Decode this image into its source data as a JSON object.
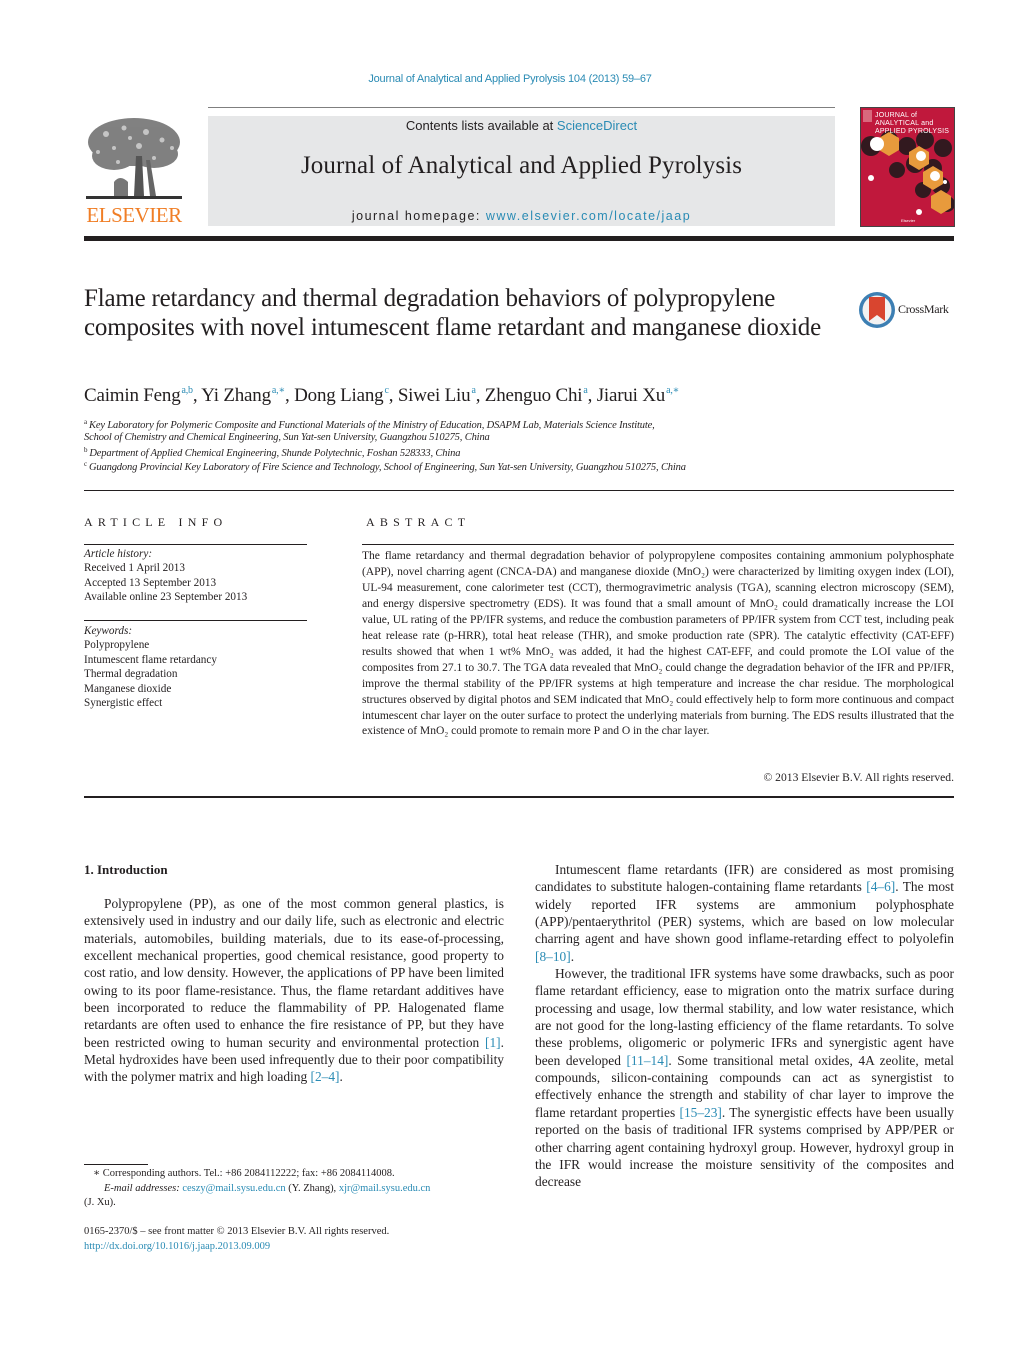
{
  "header": {
    "citation": "Journal of Analytical and Applied Pyrolysis 104 (2013) 59–67",
    "contents_prefix": "Contents lists available at ",
    "contents_link": "ScienceDirect",
    "journal_title": "Journal of Analytical and Applied Pyrolysis",
    "homepage_prefix": "journal homepage: ",
    "homepage_link": "www.elsevier.com/locate/jaap",
    "publisher_logo_text": "ELSEVIER",
    "cover_title_lines": [
      "JOURNAL of",
      "ANALYTICAL and",
      "APPLIED PYROLYSIS"
    ],
    "colors": {
      "link": "#2a8bb4",
      "elsevier_orange": "#f07e26",
      "cover_red": "#c0183c",
      "header_box": "#e6e7e8"
    }
  },
  "article": {
    "title": "Flame retardancy and thermal degradation behaviors of polypropylene composites with novel intumescent flame retardant and manganese dioxide",
    "crossmark_label": "CrossMark",
    "authors": [
      {
        "name": "Caimin Feng",
        "sup": "a,b",
        "sep": ", "
      },
      {
        "name": "Yi Zhang",
        "sup": "a,∗",
        "sep": ", "
      },
      {
        "name": "Dong Liang",
        "sup": "c",
        "sep": ", "
      },
      {
        "name": "Siwei Liu",
        "sup": "a",
        "sep": ", "
      },
      {
        "name": "Zhenguo Chi",
        "sup": "a",
        "sep": ", "
      },
      {
        "name": "Jiarui Xu",
        "sup": "a,∗",
        "sep": ""
      }
    ],
    "affiliations": [
      {
        "sup": "a",
        "text": "Key Laboratory for Polymeric Composite and Functional Materials of the Ministry of Education, DSAPM Lab, Materials Science Institute,"
      },
      {
        "sup": "",
        "text": "School of Chemistry and Chemical Engineering, Sun Yat-sen University, Guangzhou 510275, China"
      },
      {
        "sup": "b",
        "text": "Department of Applied Chemical Engineering, Shunde Polytechnic, Foshan 528333, China"
      },
      {
        "sup": "c",
        "text": "Guangdong Provincial Key Laboratory of Fire Science and Technology, School of Engineering, Sun Yat-sen University, Guangzhou 510275, China"
      }
    ]
  },
  "article_info": {
    "heading": "ARTICLE INFO",
    "history_label": "Article history:",
    "history": [
      "Received 1 April 2013",
      "Accepted 13 September 2013",
      "Available online 23 September 2013"
    ],
    "keywords_label": "Keywords:",
    "keywords": [
      "Polypropylene",
      "Intumescent flame retardancy",
      "Thermal degradation",
      "Manganese dioxide",
      "Synergistic effect"
    ]
  },
  "abstract": {
    "heading": "ABSTRACT",
    "text": "The flame retardancy and thermal degradation behavior of polypropylene composites containing ammo­nium polyphosphate (APP), novel charring agent (CNCA-DA) and manganese dioxide (MnO₂) were characterized by limiting oxygen index (LOI), UL-94 measurement, cone calorimeter test (CCT), ther­mogravimetric analysis (TGA), scanning electron microscopy (SEM), and energy dispersive spectrometry (EDS). It was found that a small amount of MnO₂ could dramatically increase the LOI value, UL rating of the PP/IFR systems, and reduce the combustion parameters of PP/IFR system from CCT test, including peak heat release rate (p-HRR), total heat release (THR), and smoke production rate (SPR). The catalytic effectivity (CAT-EFF) results showed that when 1 wt% MnO₂ was added, it had the highest CAT-EFF, and could promote the LOI value of the composites from 27.1 to 30.7. The TGA data revealed that MnO₂ could change the degradation behavior of the IFR and PP/IFR, improve the thermal stability of the PP/IFR systems at high temperature and increase the char residue. The morphological structures observed by digital photos and SEM indicated that MnO₂ could effectively help to form more continuous and compact intumescent char layer on the outer surface to protect the underlying materials from burning. The EDS results illustrated that the existence of MnO₂ could promote to remain more P and O in the char layer.",
    "copyright": "© 2013 Elsevier B.V. All rights reserved."
  },
  "body": {
    "section_heading": "1.  Introduction",
    "left_paragraphs": [
      [
        {
          "t": "Polypropylene (PP), as one of the most common general plastics, is extensively used in industry and our daily life, such as elec­tronic and electric materials, automobiles, building materials, due to its ease-of-processing, excellent mechanical properties, good chemical resistance, good property to cost ratio, and low density. However, the applications of PP have been limited owing to its poor flame-resistance. Thus, the flame retardant additives have been incorporated to reduce the flammability of PP. Halogenated flame retardants are often used to enhance the fire resistance of PP, but they have been restricted owing to human security and environmental protection "
        },
        {
          "ref": "[1]"
        },
        {
          "t": ". Metal hydroxides have been used infrequently due to their poor compatibility with the polymer matrix and high loading "
        },
        {
          "ref": "[2–4]"
        },
        {
          "t": "."
        }
      ]
    ],
    "right_paragraphs": [
      [
        {
          "t": "Intumescent flame retardants (IFR) are considered as most promising candidates to substitute halogen-containing flame retardants "
        },
        {
          "ref": "[4–6]"
        },
        {
          "t": ". The most widely reported IFR systems are ammo­nium polyphosphate (APP)/pentaerythritol (PER) systems, which are based on low molecular charring agent and have shown good inflame-retarding effect to polyolefin "
        },
        {
          "ref": "[8–10]"
        },
        {
          "t": "."
        }
      ],
      [
        {
          "t": "However, the traditional IFR systems have some drawbacks, such as poor flame retardant efficiency, ease to migration onto the matrix surface during processing and usage, low thermal stability, and low water resistance, which are not good for the long-lasting efficiency of the flame retardants. To solve these problems, oligomeric or polymeric IFRs and synergistic agent have been devel­oped "
        },
        {
          "ref": "[11–14]"
        },
        {
          "t": ". Some transitional metal oxides, 4A zeolite, metal compounds, silicon-containing compounds can act as synergistist to effectively enhance the strength and stability of char layer to improve the flame retardant properties "
        },
        {
          "ref": "[15–23]"
        },
        {
          "t": ". The synergistic effects have been usually reported on the basis of traditional IFR systems comprised by APP/PER or other charring agent contain­ing hydroxyl group. However, hydroxyl group in the IFR would increase the moisture sensitivity of the composites and decrease"
        }
      ]
    ]
  },
  "footnotes": {
    "corresponding": "∗  Corresponding authors. Tel.: +86 2084112222; fax: +86 2084114008.",
    "email_label": "E-mail addresses:",
    "email_1": "ceszy@mail.sysu.edu.cn",
    "email_1_owner": " (Y. Zhang), ",
    "email_2": "xjr@mail.sysu.edu.cn",
    "email_2_owner": "(J. Xu).",
    "issn_line": "0165-2370/$ – see front matter © 2013 Elsevier B.V. All rights reserved.",
    "doi_link": "http://dx.doi.org/10.1016/j.jaap.2013.09.009"
  }
}
